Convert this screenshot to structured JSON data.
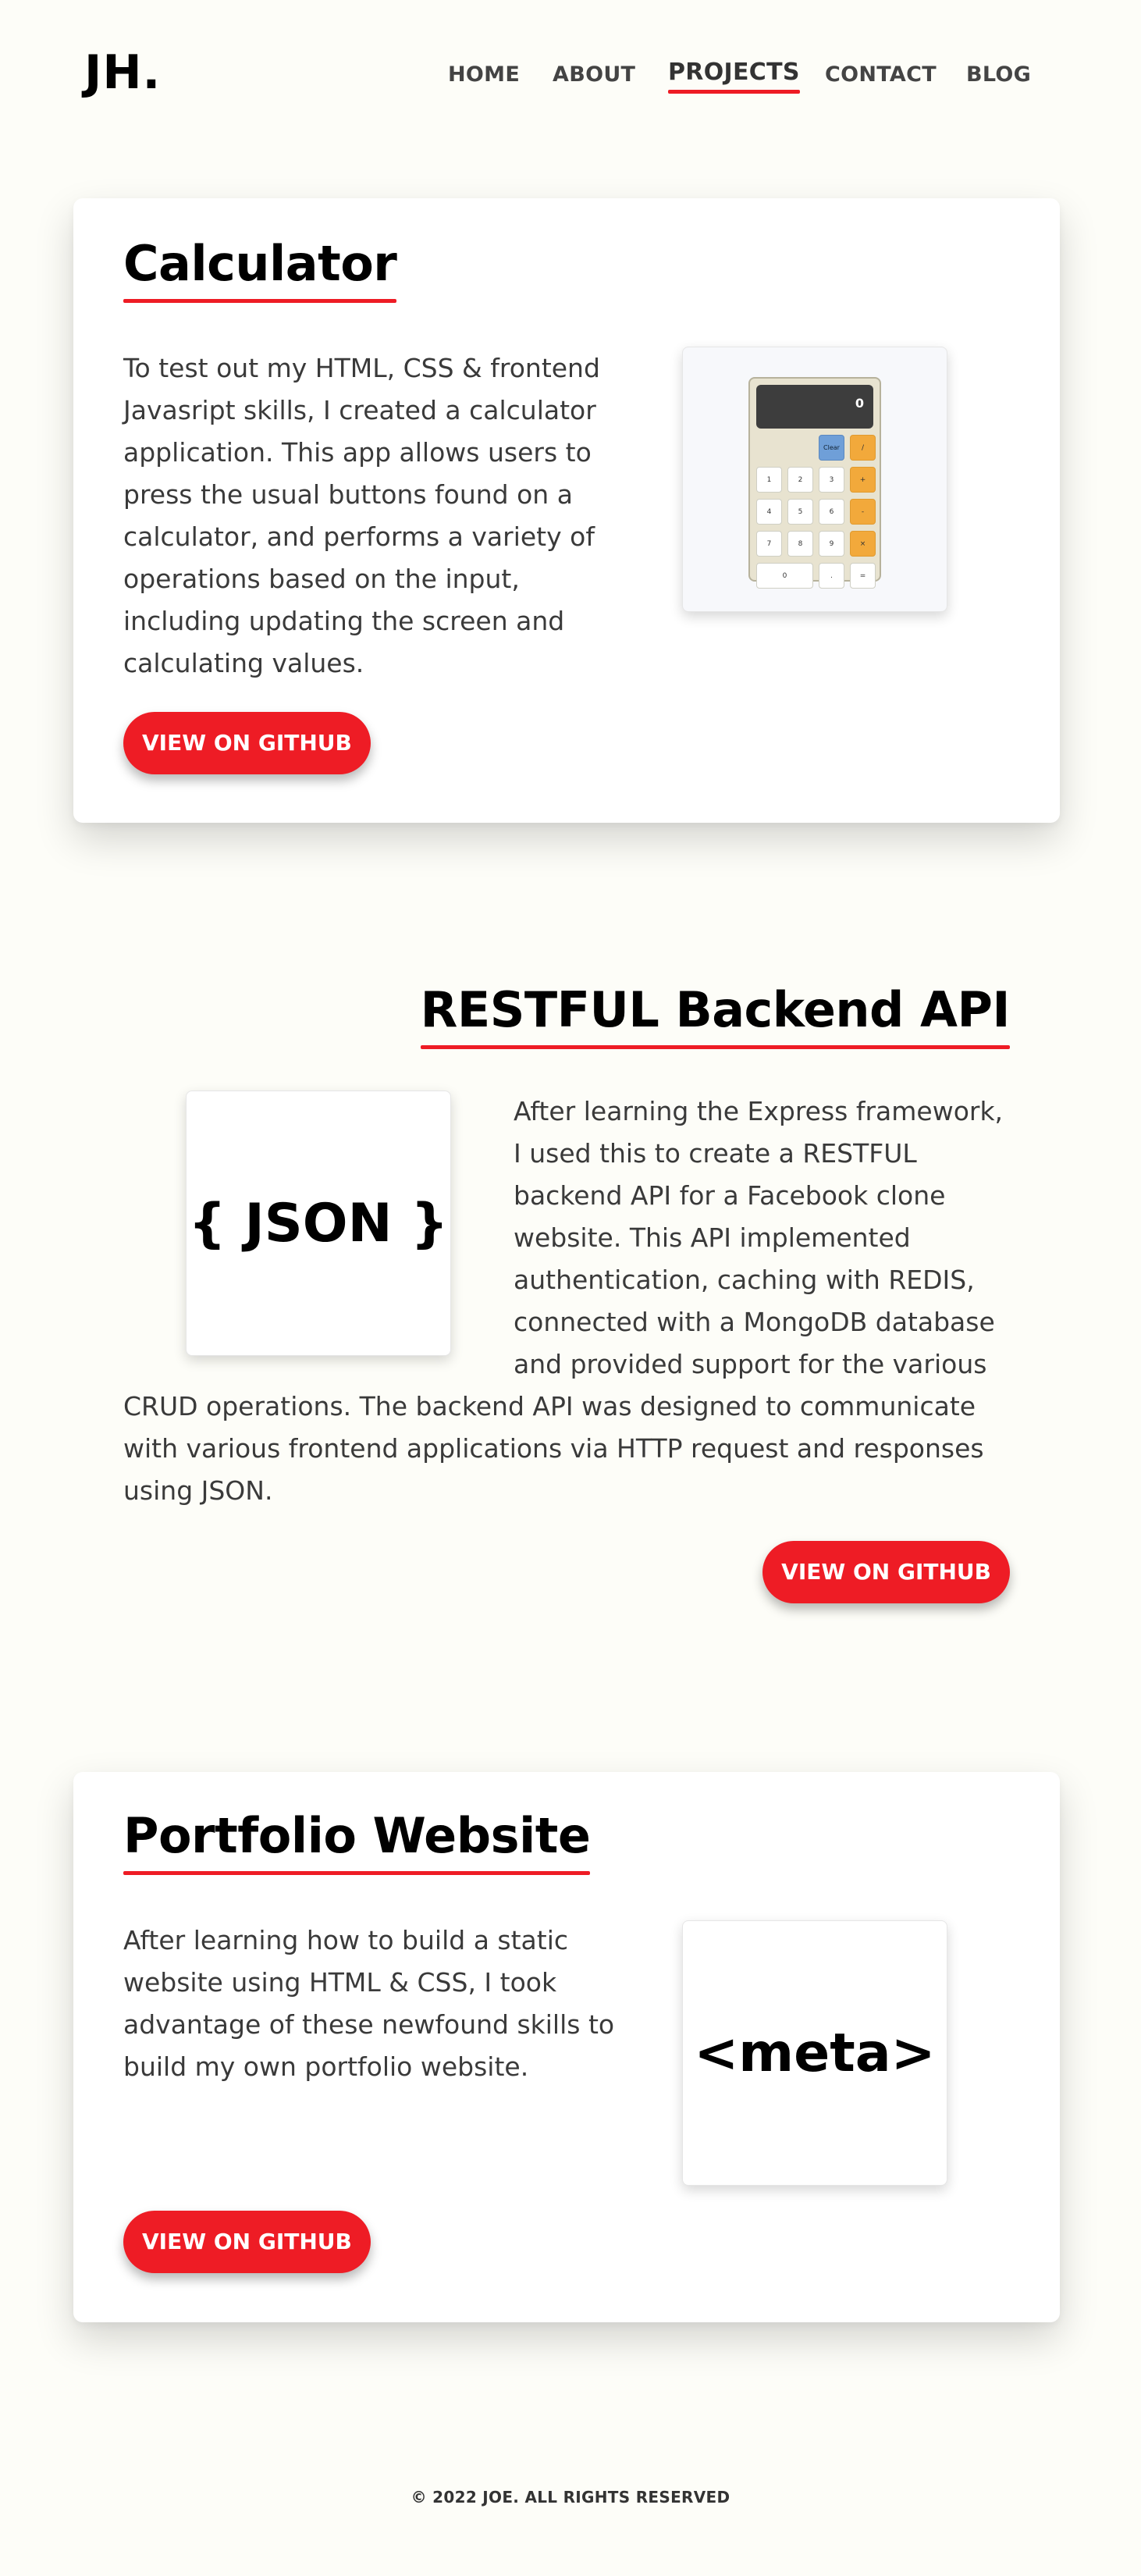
{
  "header": {
    "logo": "JH.",
    "nav": [
      {
        "label": "HOME",
        "active": false
      },
      {
        "label": "ABOUT",
        "active": false
      },
      {
        "label": "PROJECTS",
        "active": true
      },
      {
        "label": "CONTACT",
        "active": false
      },
      {
        "label": "BLOG",
        "active": false
      }
    ]
  },
  "colors": {
    "accent": "#ee1c25",
    "background": "#fdfdf8",
    "card": "#ffffff"
  },
  "projects": [
    {
      "title": "Calculator",
      "description": "To test out my HTML, CSS & frontend Javasript skills, I created a calculator application. This app allows users to press the usual buttons found on a calculator, and performs a variety of operations based on the input, including updating the screen and calculating values.",
      "button": "VIEW ON GITHUB",
      "thumbnail": {
        "type": "calculator-screenshot",
        "screen": "0",
        "keys": [
          "Clear",
          "/",
          "1",
          "2",
          "3",
          "+",
          "4",
          "5",
          "6",
          "-",
          "7",
          "8",
          "9",
          "×",
          "0",
          ".",
          "="
        ]
      }
    },
    {
      "title": "RESTFUL Backend API",
      "description": "After learning the Express framework, I used this to create a RESTFUL backend API for a Facebook clone website. This API implemented authentication, caching with REDIS, connected with a MongoDB database and provided support for the various CRUD operations. The backend API was designed to communicate with various frontend applications via HTTP request and responses using JSON.",
      "button": "VIEW ON GITHUB",
      "thumbnail": {
        "type": "text",
        "text": "{ JSON }"
      }
    },
    {
      "title": "Portfolio Website",
      "description": "After learning how to build a static website using HTML & CSS, I took advantage of these newfound skills to build my own portfolio website.",
      "button": "VIEW ON GITHUB",
      "thumbnail": {
        "type": "text",
        "text": "<meta>"
      }
    }
  ],
  "footer": "© 2022 JOE. ALL RIGHTS RESERVED"
}
